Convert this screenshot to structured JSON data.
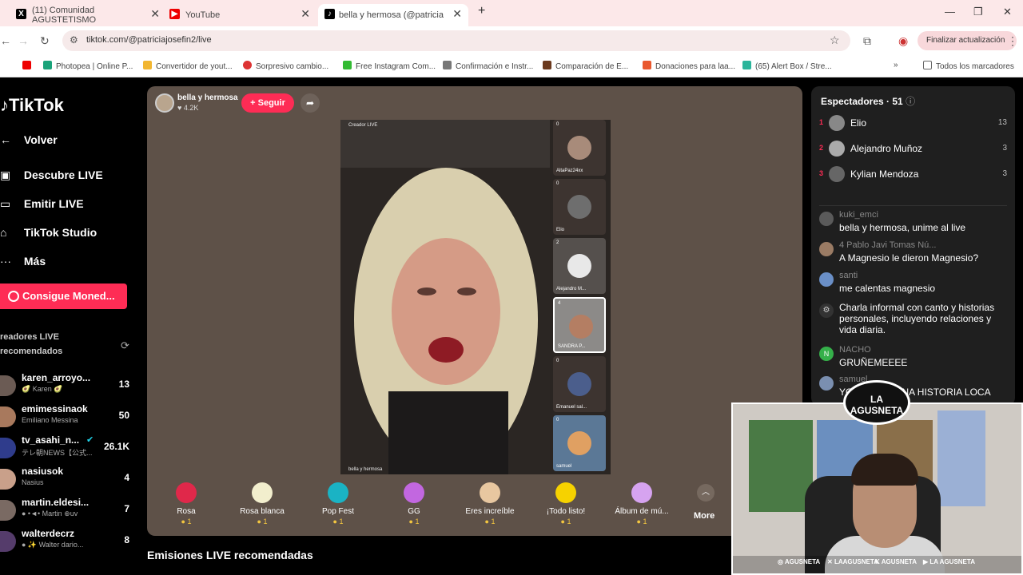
{
  "browser": {
    "tabs": [
      {
        "title": "(11) Comunidad AGUSTETISMO"
      },
      {
        "title": "YouTube"
      },
      {
        "title": "bella y hermosa (@patricia"
      }
    ],
    "url": "tiktok.com/@patriciajosefin2/live",
    "update_button": "Finalizar actualización",
    "bookmarks": [
      {
        "label": "Photopea | Online P..."
      },
      {
        "label": "Convertidor de yout..."
      },
      {
        "label": "Sorpresivo cambio..."
      },
      {
        "label": "Free Instagram Com..."
      },
      {
        "label": "Confirmación e Instr..."
      },
      {
        "label": "Comparación de E..."
      },
      {
        "label": "Donaciones para laa..."
      },
      {
        "label": "(65) Alert Box / Stre..."
      }
    ],
    "all_bookmarks": "Todos los marcadores"
  },
  "sidebar": {
    "logo": "TikTok",
    "nav": [
      {
        "label": "Volver"
      },
      {
        "label": "Descubre LIVE"
      },
      {
        "label": "Emitir LIVE"
      },
      {
        "label": "TikTok Studio"
      },
      {
        "label": "Más"
      }
    ],
    "coins_button": "Consigue Moned...",
    "recommended_title": "readores LIVE recomendados",
    "creators": [
      {
        "name": "karen_arroyo...",
        "sub": "🥑 Karen 🥑",
        "count": "13"
      },
      {
        "name": "emimessinaok",
        "sub": "Emiliano Messina",
        "count": "50"
      },
      {
        "name": "tv_asahi_n...",
        "sub": "テレ朝NEWS【公式...",
        "count": "26.1K"
      },
      {
        "name": "nasiusok",
        "sub": "Nasius",
        "count": "4"
      },
      {
        "name": "martin.eldesi...",
        "sub": "● •◄• Martin ⊕uv",
        "count": "7"
      },
      {
        "name": "walterdecrz",
        "sub": "● ✨ Walter dario...",
        "count": "8"
      }
    ]
  },
  "stage": {
    "host_name": "bella y hermosa",
    "host_likes": "♥ 4.2K",
    "follow_label": "+ Seguir",
    "creator_label": "Creador LIVE",
    "host_caption": "bella y hermosa",
    "guests": [
      {
        "name": "AltaPaz24xx",
        "count": "0"
      },
      {
        "name": "Elio",
        "count": "0"
      },
      {
        "name": "Alejandro M...",
        "count": "2"
      },
      {
        "name": "SANDRA P...",
        "count": "4"
      },
      {
        "name": "Emanuel sal...",
        "count": "0"
      },
      {
        "name": "samuel",
        "count": "0"
      }
    ],
    "gifts": [
      {
        "name": "Rosa",
        "price": "1"
      },
      {
        "name": "Rosa blanca",
        "price": "1"
      },
      {
        "name": "Pop Fest",
        "price": "1"
      },
      {
        "name": "GG",
        "price": "1"
      },
      {
        "name": "Eres increíble",
        "price": "1"
      },
      {
        "name": "¡Todo listo!",
        "price": "1"
      },
      {
        "name": "Álbum de mú...",
        "price": "1"
      }
    ],
    "more_label": "More"
  },
  "emisiones_title": "Emisiones LIVE recomendadas",
  "panel": {
    "title": "Espectadores · 51",
    "viewers": [
      {
        "rank": "1",
        "name": "Elio",
        "score": "13"
      },
      {
        "rank": "2",
        "name": "Alejandro Muñoz",
        "score": "3"
      },
      {
        "rank": "3",
        "name": "Kylian Mendoza",
        "score": "3"
      }
    ],
    "messages": [
      {
        "user": "kuki_emci",
        "text": "bella y hermosa, unime al live"
      },
      {
        "user": "4 Pablo Javi Tomas Nú...",
        "text": "A Magnesio le dieron Magnesio?"
      },
      {
        "user": "santi",
        "text": "me calentas magnesio"
      },
      {
        "user": "",
        "text": "Charla informal con canto y historias personales, incluyendo relaciones y vida diaria."
      },
      {
        "user": "NACHO",
        "text": "GRUÑEMEEEE"
      },
      {
        "user": "samuel",
        "text": "YOOO TE D UNA HISTORIA LOCA"
      }
    ]
  },
  "webcam": {
    "logo_text": "LA AGUSNETA",
    "socials": [
      "AGUSNETA",
      "LAAGUSNETA",
      "AGUSNETA",
      "LA AGUSNETA"
    ]
  },
  "colors": {
    "accent": "#fe2c55",
    "stage_bg": "#5e5148"
  }
}
